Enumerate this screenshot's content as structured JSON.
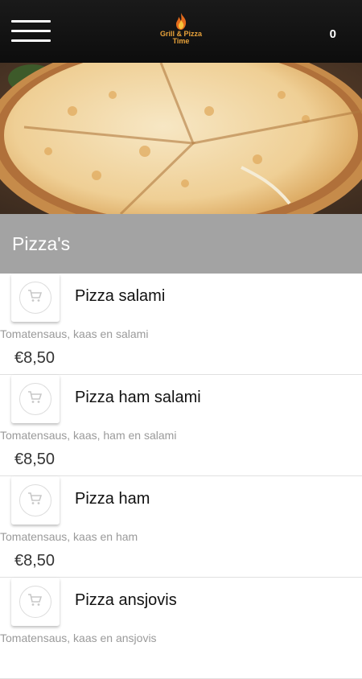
{
  "header": {
    "logo_line1": "Grill & Pizza",
    "logo_line2": "Time",
    "cart_count": "0"
  },
  "section": {
    "title": "Pizza's"
  },
  "products": [
    {
      "name": "Pizza salami",
      "description": "Tomatensaus, kaas en salami",
      "price": "€8,50"
    },
    {
      "name": "Pizza ham salami",
      "description": "Tomatensaus, kaas, ham en salami",
      "price": "€8,50"
    },
    {
      "name": "Pizza ham",
      "description": "Tomatensaus, kaas en ham",
      "price": "€8,50"
    },
    {
      "name": "Pizza ansjovis",
      "description": "Tomatensaus, kaas en ansjovis",
      "price": ""
    }
  ],
  "icons": {
    "menu": "hamburger-menu-icon",
    "logo": "flame-logo-icon",
    "cart": "shopping-cart-icon"
  },
  "colors": {
    "topbar": "#111111",
    "section_header": "#a3a3a3",
    "logo_text": "#e8a23a",
    "description_text": "#9a9a9a"
  }
}
